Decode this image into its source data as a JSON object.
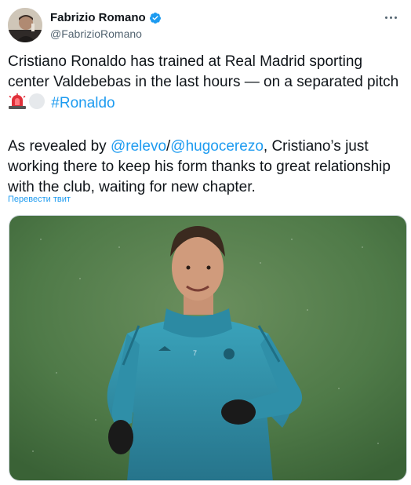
{
  "tweet": {
    "author": {
      "display_name": "Fabrizio Romano",
      "handle": "@FabrizioRomano",
      "verified": true,
      "avatar_icon": "avatar-photo-icon"
    },
    "more_icon": "more-options-icon",
    "paragraph1": {
      "text_before_emojis": "Cristiano Ronaldo has trained at Real Madrid sporting center Valdebebas in the last hours — on a separated pitch ",
      "emojis": [
        "rotating-light-emoji",
        "white-circle-emoji"
      ],
      "hashtag": "#Ronaldo"
    },
    "paragraph2": {
      "text_start": "As revealed by ",
      "mention1": "@relevo",
      "separator": "/",
      "mention2": "@hugocerezo",
      "text_end": ", Cristiano’s just working there to keep his form thanks to great relationship with the club, waiting for new chapter."
    },
    "translate_label": "Перевести твит",
    "media": {
      "kind": "photo",
      "subject": "photo-of-player-training-in-rain"
    },
    "colors": {
      "link": "#1d9bf0",
      "text": "#0f1419",
      "secondary": "#536471",
      "verified": "#1d9bf0",
      "pitch_green": "#4f7a48",
      "jersey_teal": "#2f8fa8"
    }
  }
}
